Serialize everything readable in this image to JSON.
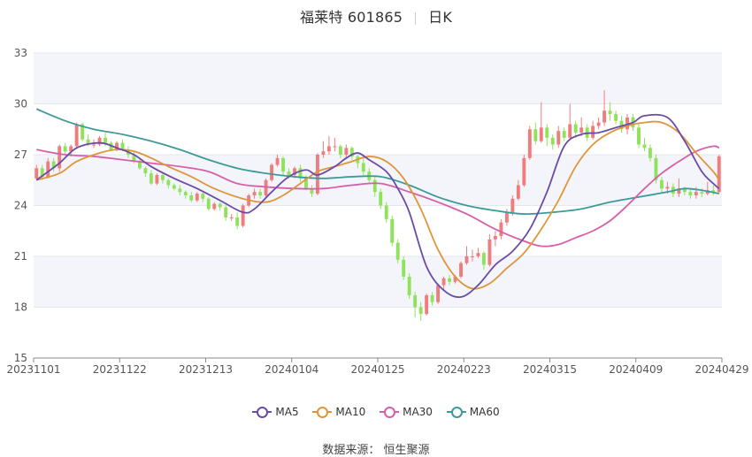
{
  "header": {
    "name": "福莱特 601865",
    "period": "日K"
  },
  "source": "数据来源：  恒生聚源",
  "colors": {
    "up": "#f07d7d",
    "down": "#8fe35b",
    "ma5": "#6a4ca6",
    "ma10": "#e0953b",
    "ma30": "#d660a8",
    "ma60": "#3e9a9a",
    "band": "#f3f5fb",
    "grid": "#e4e7ee"
  },
  "chart_data": {
    "type": "candlestick",
    "title": "福莱特 601865 日K",
    "ylim": [
      15,
      33
    ],
    "yticks": [
      15,
      18,
      21,
      24,
      27,
      30,
      33
    ],
    "xtick_labels": [
      "20231101",
      "20231122",
      "20231213",
      "20240104",
      "20240125",
      "20240223",
      "20240315",
      "20240409",
      "20240429"
    ],
    "xtick_index": [
      0,
      15,
      30,
      45,
      60,
      75,
      90,
      105,
      119
    ],
    "legend": [
      "MA5",
      "MA10",
      "MA30",
      "MA60"
    ],
    "candles": [
      [
        25.6,
        26.2,
        26.4,
        25.5
      ],
      [
        26.2,
        25.7,
        26.4,
        25.5
      ],
      [
        25.7,
        26.6,
        26.8,
        25.6
      ],
      [
        26.6,
        26.2,
        26.8,
        26.0
      ],
      [
        26.2,
        27.5,
        27.6,
        26.0
      ],
      [
        27.5,
        27.2,
        27.7,
        27.0
      ],
      [
        27.2,
        27.5,
        27.6,
        26.9
      ],
      [
        27.5,
        28.8,
        28.9,
        27.4
      ],
      [
        28.8,
        27.9,
        28.9,
        27.8
      ],
      [
        27.9,
        27.6,
        28.2,
        27.5
      ],
      [
        27.6,
        27.6,
        27.9,
        27.4
      ],
      [
        27.6,
        28.0,
        28.1,
        27.5
      ],
      [
        28.0,
        27.7,
        28.3,
        27.5
      ],
      [
        27.7,
        27.3,
        27.8,
        27.2
      ],
      [
        27.3,
        27.7,
        27.8,
        27.2
      ],
      [
        27.7,
        27.3,
        27.9,
        27.2
      ],
      [
        27.3,
        27.0,
        27.5,
        26.8
      ],
      [
        27.0,
        26.6,
        27.2,
        26.5
      ],
      [
        26.6,
        26.2,
        26.8,
        26.1
      ],
      [
        26.2,
        25.9,
        26.3,
        25.7
      ],
      [
        25.9,
        25.3,
        26.1,
        25.2
      ],
      [
        25.3,
        25.8,
        25.9,
        25.2
      ],
      [
        25.8,
        25.5,
        25.9,
        25.3
      ],
      [
        25.5,
        25.2,
        25.6,
        25.0
      ],
      [
        25.2,
        25.0,
        25.3,
        24.9
      ],
      [
        25.0,
        24.8,
        25.2,
        24.6
      ],
      [
        24.8,
        24.6,
        24.9,
        24.4
      ],
      [
        24.6,
        24.3,
        24.8,
        24.2
      ],
      [
        24.3,
        24.7,
        24.8,
        24.2
      ],
      [
        24.7,
        24.4,
        24.8,
        24.2
      ],
      [
        24.4,
        23.8,
        24.5,
        23.7
      ],
      [
        23.8,
        24.1,
        24.2,
        23.7
      ],
      [
        24.1,
        23.9,
        24.2,
        23.7
      ],
      [
        23.9,
        23.3,
        24.0,
        23.1
      ],
      [
        23.3,
        23.3,
        23.5,
        23.1
      ],
      [
        23.3,
        22.8,
        23.6,
        22.6
      ],
      [
        22.8,
        24.0,
        24.1,
        22.7
      ],
      [
        24.0,
        24.6,
        24.7,
        23.9
      ],
      [
        24.6,
        24.8,
        25.0,
        24.4
      ],
      [
        24.8,
        24.6,
        25.0,
        24.4
      ],
      [
        24.6,
        25.5,
        25.6,
        24.5
      ],
      [
        25.5,
        26.4,
        26.5,
        25.4
      ],
      [
        26.4,
        26.8,
        27.0,
        26.3
      ],
      [
        26.8,
        26.0,
        26.9,
        25.8
      ],
      [
        26.0,
        25.8,
        26.2,
        25.6
      ],
      [
        25.8,
        26.2,
        26.3,
        25.6
      ],
      [
        26.2,
        25.6,
        26.4,
        25.4
      ],
      [
        25.6,
        25.0,
        25.8,
        24.9
      ],
      [
        25.0,
        24.7,
        25.2,
        24.5
      ],
      [
        24.7,
        27.0,
        27.1,
        24.6
      ],
      [
        27.0,
        27.2,
        27.8,
        26.8
      ],
      [
        27.2,
        27.5,
        28.1,
        27.0
      ],
      [
        27.5,
        27.5,
        28.0,
        27.2
      ],
      [
        27.5,
        27.0,
        27.6,
        26.8
      ],
      [
        27.0,
        27.4,
        27.6,
        26.8
      ],
      [
        27.4,
        26.9,
        27.5,
        26.7
      ],
      [
        26.9,
        26.5,
        27.0,
        26.2
      ],
      [
        26.5,
        26.0,
        26.8,
        25.8
      ],
      [
        26.0,
        25.5,
        26.2,
        25.3
      ],
      [
        25.5,
        24.8,
        25.7,
        24.5
      ],
      [
        24.8,
        24.0,
        25.0,
        23.8
      ],
      [
        24.0,
        23.2,
        24.2,
        23.0
      ],
      [
        23.2,
        21.8,
        23.4,
        21.6
      ],
      [
        21.8,
        20.8,
        22.0,
        20.6
      ],
      [
        20.8,
        19.8,
        21.0,
        19.6
      ],
      [
        19.8,
        18.7,
        20.0,
        18.5
      ],
      [
        18.7,
        18.0,
        18.9,
        17.4
      ],
      [
        18.0,
        17.6,
        18.3,
        17.2
      ],
      [
        17.6,
        18.7,
        18.8,
        17.5
      ],
      [
        18.7,
        18.3,
        18.9,
        18.1
      ],
      [
        18.3,
        19.3,
        19.4,
        18.2
      ],
      [
        19.3,
        19.7,
        19.8,
        19.0
      ],
      [
        19.7,
        19.5,
        19.9,
        19.3
      ],
      [
        19.5,
        19.8,
        19.9,
        19.4
      ],
      [
        19.8,
        20.6,
        20.7,
        19.7
      ],
      [
        20.6,
        21.0,
        21.6,
        20.5
      ],
      [
        21.0,
        21.0,
        21.4,
        20.7
      ],
      [
        21.0,
        21.2,
        21.5,
        20.9
      ],
      [
        21.2,
        20.5,
        21.3,
        20.2
      ],
      [
        20.5,
        22.0,
        22.3,
        20.4
      ],
      [
        22.0,
        22.2,
        22.5,
        21.6
      ],
      [
        22.2,
        23.0,
        23.2,
        22.0
      ],
      [
        23.0,
        23.6,
        23.8,
        22.8
      ],
      [
        23.6,
        24.4,
        24.6,
        23.4
      ],
      [
        24.4,
        25.2,
        25.5,
        24.3
      ],
      [
        25.2,
        26.8,
        27.0,
        25.1
      ],
      [
        26.8,
        28.5,
        28.7,
        26.7
      ],
      [
        28.5,
        27.8,
        28.9,
        27.6
      ],
      [
        27.8,
        28.6,
        30.1,
        27.7
      ],
      [
        28.6,
        28.0,
        28.8,
        27.5
      ],
      [
        28.0,
        27.6,
        28.2,
        27.3
      ],
      [
        27.6,
        28.4,
        28.7,
        27.4
      ],
      [
        28.4,
        28.0,
        28.6,
        27.8
      ],
      [
        28.0,
        28.8,
        30.0,
        27.9
      ],
      [
        28.8,
        28.3,
        29.0,
        28.0
      ],
      [
        28.3,
        28.6,
        29.2,
        28.1
      ],
      [
        28.6,
        28.0,
        28.8,
        27.8
      ],
      [
        28.0,
        28.7,
        29.0,
        27.9
      ],
      [
        28.7,
        28.9,
        29.2,
        28.5
      ],
      [
        28.9,
        29.6,
        30.8,
        28.7
      ],
      [
        29.6,
        29.4,
        30.1,
        29.0
      ],
      [
        29.4,
        29.0,
        29.6,
        28.8
      ],
      [
        29.0,
        28.5,
        29.3,
        28.3
      ],
      [
        28.5,
        29.2,
        29.4,
        28.2
      ],
      [
        29.2,
        28.6,
        29.4,
        28.4
      ],
      [
        28.6,
        27.6,
        28.8,
        27.4
      ],
      [
        27.6,
        27.4,
        28.0,
        27.2
      ],
      [
        27.4,
        26.8,
        27.6,
        26.6
      ],
      [
        26.8,
        25.5,
        27.0,
        25.3
      ],
      [
        25.5,
        25.0,
        25.7,
        24.8
      ],
      [
        25.0,
        25.1,
        25.4,
        24.7
      ],
      [
        25.1,
        24.7,
        25.3,
        24.5
      ],
      [
        24.7,
        25.0,
        25.6,
        24.5
      ],
      [
        25.0,
        24.8,
        25.1,
        24.6
      ],
      [
        24.8,
        24.6,
        25.0,
        24.4
      ],
      [
        24.6,
        24.8,
        25.1,
        24.4
      ],
      [
        24.8,
        24.7,
        25.0,
        24.5
      ],
      [
        24.7,
        24.9,
        25.4,
        24.6
      ],
      [
        24.9,
        24.8,
        25.2,
        24.6
      ],
      [
        24.8,
        26.9,
        27.0,
        24.7
      ]
    ],
    "ma_lines": {
      "MA5": [
        [
          0,
          25.5
        ],
        [
          4,
          26.5
        ],
        [
          7,
          27.4
        ],
        [
          11,
          27.7
        ],
        [
          14,
          27.4
        ],
        [
          17,
          27.0
        ],
        [
          20,
          26.3
        ],
        [
          24,
          25.6
        ],
        [
          28,
          25.0
        ],
        [
          32,
          24.3
        ],
        [
          36,
          23.6
        ],
        [
          38,
          23.8
        ],
        [
          41,
          24.8
        ],
        [
          44,
          25.7
        ],
        [
          47,
          26.1
        ],
        [
          49,
          25.8
        ],
        [
          52,
          26.3
        ],
        [
          54,
          26.8
        ],
        [
          56,
          27.1
        ],
        [
          58,
          26.7
        ],
        [
          61,
          26.0
        ],
        [
          63,
          25.0
        ],
        [
          65,
          23.6
        ],
        [
          68,
          20.4
        ],
        [
          71,
          19.0
        ],
        [
          74,
          18.6
        ],
        [
          77,
          19.3
        ],
        [
          80,
          20.5
        ],
        [
          83,
          21.3
        ],
        [
          86,
          22.6
        ],
        [
          89,
          24.8
        ],
        [
          92,
          27.5
        ],
        [
          95,
          28.2
        ],
        [
          98,
          28.3
        ],
        [
          101,
          28.6
        ],
        [
          104,
          28.9
        ],
        [
          106,
          29.3
        ],
        [
          110,
          29.2
        ],
        [
          113,
          27.8
        ],
        [
          116,
          26.0
        ],
        [
          118,
          25.3
        ],
        [
          119,
          25.0
        ]
      ],
      "MA10": [
        [
          0,
          25.5
        ],
        [
          4,
          25.9
        ],
        [
          7,
          26.6
        ],
        [
          11,
          27.1
        ],
        [
          14,
          27.3
        ],
        [
          17,
          27.2
        ],
        [
          20,
          26.8
        ],
        [
          23,
          26.3
        ],
        [
          27,
          25.7
        ],
        [
          31,
          25.0
        ],
        [
          36,
          24.4
        ],
        [
          40,
          24.2
        ],
        [
          43,
          24.6
        ],
        [
          46,
          25.3
        ],
        [
          49,
          26.0
        ],
        [
          52,
          26.3
        ],
        [
          55,
          26.6
        ],
        [
          58,
          26.9
        ],
        [
          61,
          26.6
        ],
        [
          64,
          25.6
        ],
        [
          67,
          23.8
        ],
        [
          70,
          21.4
        ],
        [
          73,
          19.8
        ],
        [
          76,
          19.1
        ],
        [
          79,
          19.4
        ],
        [
          82,
          20.3
        ],
        [
          85,
          21.2
        ],
        [
          88,
          22.6
        ],
        [
          91,
          24.3
        ],
        [
          94,
          26.3
        ],
        [
          97,
          27.6
        ],
        [
          100,
          28.3
        ],
        [
          103,
          28.7
        ],
        [
          106,
          28.9
        ],
        [
          109,
          28.9
        ],
        [
          112,
          28.3
        ],
        [
          115,
          27.1
        ],
        [
          118,
          26.0
        ],
        [
          119,
          25.5
        ]
      ],
      "MA30": [
        [
          0,
          27.3
        ],
        [
          5,
          27.0
        ],
        [
          10,
          26.9
        ],
        [
          15,
          26.7
        ],
        [
          20,
          26.5
        ],
        [
          25,
          26.3
        ],
        [
          30,
          26.0
        ],
        [
          35,
          25.3
        ],
        [
          40,
          25.1
        ],
        [
          45,
          25.0
        ],
        [
          50,
          25.0
        ],
        [
          55,
          25.2
        ],
        [
          60,
          25.3
        ],
        [
          65,
          24.8
        ],
        [
          70,
          24.2
        ],
        [
          75,
          23.5
        ],
        [
          80,
          22.6
        ],
        [
          85,
          21.9
        ],
        [
          88,
          21.6
        ],
        [
          91,
          21.7
        ],
        [
          94,
          22.1
        ],
        [
          97,
          22.5
        ],
        [
          100,
          23.1
        ],
        [
          103,
          24.0
        ],
        [
          106,
          25.0
        ],
        [
          109,
          25.9
        ],
        [
          112,
          26.6
        ],
        [
          115,
          27.2
        ],
        [
          118,
          27.5
        ],
        [
          119,
          27.4
        ]
      ],
      "MA60": [
        [
          0,
          29.7
        ],
        [
          5,
          29.0
        ],
        [
          10,
          28.5
        ],
        [
          15,
          28.2
        ],
        [
          20,
          27.8
        ],
        [
          25,
          27.3
        ],
        [
          30,
          26.7
        ],
        [
          35,
          26.2
        ],
        [
          40,
          25.9
        ],
        [
          45,
          25.7
        ],
        [
          50,
          25.6
        ],
        [
          55,
          25.7
        ],
        [
          60,
          25.7
        ],
        [
          65,
          25.2
        ],
        [
          70,
          24.5
        ],
        [
          75,
          24.0
        ],
        [
          80,
          23.7
        ],
        [
          85,
          23.5
        ],
        [
          90,
          23.6
        ],
        [
          95,
          23.8
        ],
        [
          100,
          24.2
        ],
        [
          105,
          24.5
        ],
        [
          110,
          24.8
        ],
        [
          113,
          25.0
        ],
        [
          116,
          24.9
        ],
        [
          119,
          24.7
        ]
      ]
    }
  }
}
